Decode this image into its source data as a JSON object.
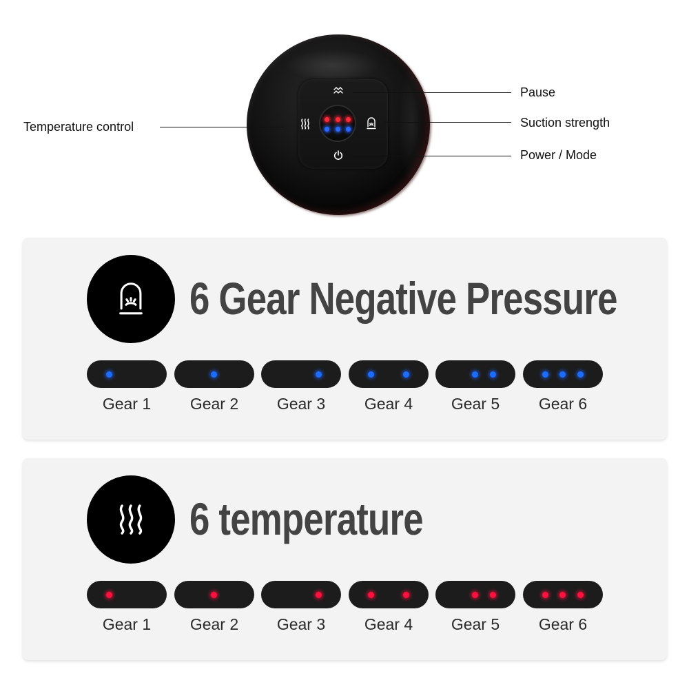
{
  "device": {
    "icons": {
      "top": "pause-wave-icon",
      "left": "heat-waves-icon",
      "right": "suction-cup-icon",
      "bottom": "power-icon"
    },
    "center_leds": {
      "red_count": 3,
      "blue_count": 3,
      "red_color": "#ff2a3a",
      "blue_color": "#2b6bff"
    },
    "callouts": {
      "temperature": "Temperature control",
      "pause": "Pause",
      "suction": "Suction strength",
      "power": "Power / Mode"
    }
  },
  "pressure_card": {
    "icon": "suction-cup-icon",
    "title": "6 Gear Negative Pressure",
    "dot_color": "#1a6dff",
    "gears": [
      {
        "label": "Gear 1",
        "dots": [
          "left"
        ]
      },
      {
        "label": "Gear 2",
        "dots": [
          "center"
        ]
      },
      {
        "label": "Gear 3",
        "dots": [
          "right"
        ]
      },
      {
        "label": "Gear 4",
        "dots": [
          "left",
          "right"
        ]
      },
      {
        "label": "Gear 5",
        "dots": [
          "center",
          "right"
        ]
      },
      {
        "label": "Gear 6",
        "dots": [
          "left",
          "center",
          "right"
        ]
      }
    ]
  },
  "temperature_card": {
    "icon": "heat-waves-icon",
    "title": "6 temperature",
    "dot_color": "#ff1040",
    "gears": [
      {
        "label": "Gear 1",
        "dots": [
          "left"
        ]
      },
      {
        "label": "Gear 2",
        "dots": [
          "center"
        ]
      },
      {
        "label": "Gear 3",
        "dots": [
          "right"
        ]
      },
      {
        "label": "Gear 4",
        "dots": [
          "left",
          "right"
        ]
      },
      {
        "label": "Gear 5",
        "dots": [
          "center",
          "right"
        ]
      },
      {
        "label": "Gear 6",
        "dots": [
          "left",
          "center",
          "right"
        ]
      }
    ]
  }
}
